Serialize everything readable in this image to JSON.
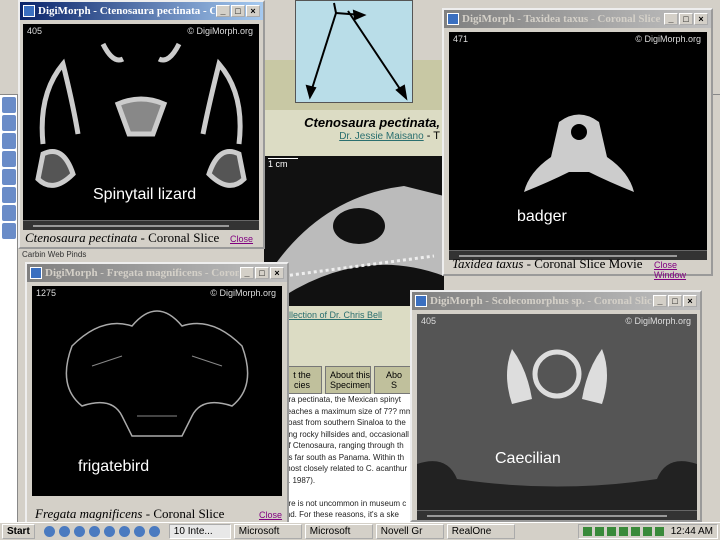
{
  "colors": {
    "title_active": "#0a246a",
    "title_inactive": "#808080",
    "diagram_bg": "#b9dde8",
    "link": "#2a6f6f"
  },
  "background_page": {
    "species_title": "Ctenosaura pectinata,",
    "author_link": "Dr. Jessie Maisano",
    "author_suffix": "- T",
    "scale_label": "1 cm",
    "credit_link": "ollection of Dr. Chris Bell",
    "tabs": [
      "t the\ncies",
      "About this\nSpecimen",
      "Abo\nS"
    ],
    "body_lines": [
      "ura pectinata, the Mexican spinyt",
      "reaches a maximum size of 7?? mm.",
      "coast from southern Sinaloa to the",
      "ring rocky hillsides and, occasionall",
      "of Ctenosaura, ranging through th",
      "as far south as Panama. Within th",
      "most closely related to C. acanthur",
      "z. 1987).",
      "",
      "ure is not uncommon in museum c",
      "ind. For these reasons, it's a ske"
    ],
    "sidebar_item": "Carbin Web Pinds"
  },
  "windows": [
    {
      "title": "DigiMorph - Ctenosaura pectinata - Coronal Sli...",
      "frame": "405",
      "watermark": "© DigiMorph.org",
      "label": "Spinytail lizard",
      "caption_italic": "Ctenosaura pectinata",
      "caption_rest": " - Coronal Slice",
      "close": "Close"
    },
    {
      "title": "DigiMorph - Taxidea taxus - Coronal Slice Movie",
      "frame": "471",
      "watermark": "© DigiMorph.org",
      "label": "badger",
      "caption_italic": "Taxidea taxus",
      "caption_rest": " - Coronal Slice Movie",
      "close": "Close Window"
    },
    {
      "title": "DigiMorph - Fregata magnificens - Coronal Slice",
      "frame": "1275",
      "watermark": "© DigiMorph.org",
      "label": "frigatebird",
      "caption_italic": "Fregata magnificens",
      "caption_rest": " - Coronal Slice",
      "close": "Close"
    },
    {
      "title": "DigiMorph - Scolecomorphus sp. - Coronal Slice M...",
      "frame": "405",
      "watermark": "© DigiMorph.org",
      "label": "Caecilian"
    }
  ],
  "taskbar": {
    "start": "Start",
    "buttons": [
      "10 Inte...",
      "Microsoft",
      "Microsoft",
      "Novell Gr",
      "RealOne"
    ],
    "clock": "12:44 AM"
  }
}
